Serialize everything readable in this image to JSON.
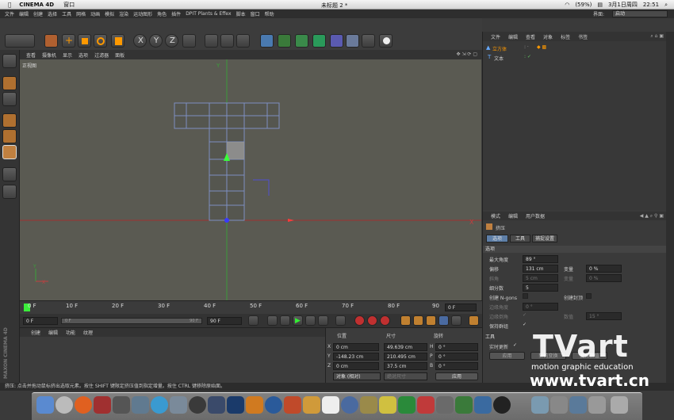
{
  "mac_menu": {
    "app_name": "CINEMA 4D",
    "window_menu": "窗口",
    "window_title": "未标题 2 *",
    "battery": "(59%)",
    "date": "3月1日周四",
    "time": "22:51"
  },
  "app_menu": [
    "文件",
    "编辑",
    "创建",
    "选择",
    "工具",
    "网格",
    "动画",
    "模拟",
    "渲染",
    "运动图形",
    "角色",
    "插件",
    "DPIT Plants & Effex",
    "脚本",
    "窗口",
    "帮助"
  ],
  "layout": {
    "label": "界面:",
    "value": "启动"
  },
  "viewport": {
    "menu": [
      "查看",
      "摄像机",
      "显示",
      "选项",
      "过滤器",
      "面板"
    ],
    "view_name": "正视图"
  },
  "timeline": {
    "ticks": [
      "0 F",
      "10 F",
      "20 F",
      "30 F",
      "40 F",
      "50 F",
      "60 F",
      "70 F",
      "80 F",
      "90"
    ],
    "current_field": "0 F",
    "frame_max": 90
  },
  "transport": {
    "start": "0 F",
    "range_left": "0 F",
    "range_right": "90 F",
    "end": "90 F"
  },
  "material_menu": [
    "创建",
    "编辑",
    "功能",
    "纹理"
  ],
  "coords": {
    "headers": [
      "位置",
      "尺寸",
      "旋转"
    ],
    "rows": [
      {
        "axis": "X",
        "pos": "0 cm",
        "size": "49.639 cm",
        "rot_label": "H",
        "rot": "0 °"
      },
      {
        "axis": "Y",
        "pos": "-148.23 cm",
        "size": "210.495 cm",
        "rot_label": "P",
        "rot": "0 °"
      },
      {
        "axis": "Z",
        "pos": "0 cm",
        "size": "37.5 cm",
        "rot_label": "B",
        "rot": "0 °"
      }
    ],
    "mode_left": "对象 (相对)",
    "mode_mid": "绝对尺寸",
    "apply": "应用"
  },
  "objects": {
    "menu": [
      "文件",
      "编辑",
      "查看",
      "对象",
      "标签",
      "书签"
    ],
    "items": [
      {
        "name": "立方体"
      },
      {
        "name": "文本"
      }
    ]
  },
  "attributes": {
    "menu": [
      "模式",
      "编辑",
      "用户数据"
    ],
    "object_name": "挤压",
    "tabs": [
      "选项",
      "工具",
      "捕捉设置"
    ],
    "section_options": "选项",
    "fields": [
      {
        "label": "最大角度",
        "value": "89 °"
      },
      {
        "label": "偏移",
        "value": "131 cm"
      },
      {
        "label": "斜角",
        "value": "5 cm"
      },
      {
        "label": "细分数",
        "value": "5"
      }
    ],
    "variance_label": "变量",
    "variance_value": "0 %",
    "variance2_label": "变量",
    "variance2_value": "0 %",
    "create_ngons": "创建 N-gons",
    "create_caps": "创建封顶",
    "edge_angle": "边缘角度",
    "edge_angle_value": "0 °",
    "edge_bevel": "边缘倒角",
    "value_label": "数值",
    "value_value": "15 °",
    "keep_groups": "保持群组",
    "section_tools": "工具",
    "realtime": "实时更新",
    "apply": "应用",
    "new_transform": "新的变换",
    "reset": "复位数值"
  },
  "status": "挤压: 点击并拖动鼠标挤出选取元素。按住 SHIFT 键限定挤压值到指定增量。按住 CTRL 键移除原始面。",
  "watermark": {
    "logo": "TVart",
    "tagline": "motion graphic education",
    "url": "www.tvart.cn"
  },
  "sidebar_vertical": "MAXON CINEMA 4D"
}
